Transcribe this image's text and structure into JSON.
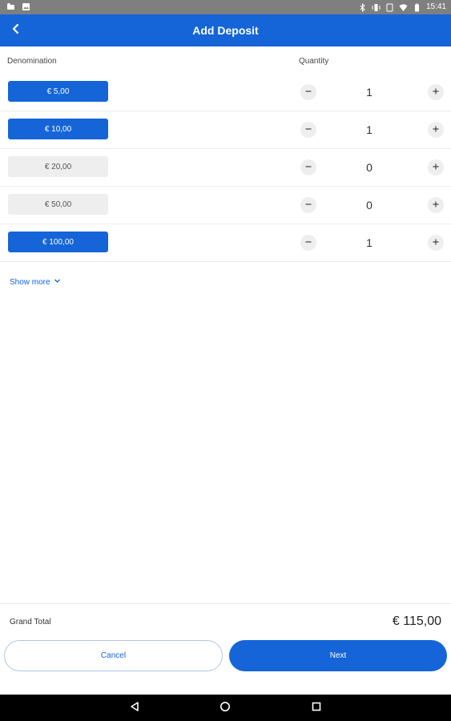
{
  "status_bar": {
    "time": "15:41",
    "icons": [
      "notification-icon",
      "image-icon",
      "bluetooth-icon",
      "vibrate-icon",
      "rotate-icon",
      "wifi-icon",
      "battery-icon"
    ]
  },
  "app_bar": {
    "title": "Add Deposit",
    "back_icon": "chevron-left-icon"
  },
  "table": {
    "col_denomination": "Denomination",
    "col_quantity": "Quantity",
    "rows": [
      {
        "denomination": "€ 5,00",
        "quantity": "1",
        "selected": true
      },
      {
        "denomination": "€ 10,00",
        "quantity": "1",
        "selected": true
      },
      {
        "denomination": "€ 20,00",
        "quantity": "0",
        "selected": false
      },
      {
        "denomination": "€ 50,00",
        "quantity": "0",
        "selected": false
      },
      {
        "denomination": "€ 100,00",
        "quantity": "1",
        "selected": true
      }
    ]
  },
  "show_more": {
    "label": "Show more",
    "icon": "chevron-down-icon"
  },
  "footer": {
    "grand_total_label": "Grand Total",
    "grand_total_value": "€ 115,00",
    "cancel_label": "Cancel",
    "next_label": "Next"
  },
  "colors": {
    "primary": "#1565d8",
    "status_bar": "#7f7f7f",
    "inactive_denom": "#eeeeee"
  }
}
